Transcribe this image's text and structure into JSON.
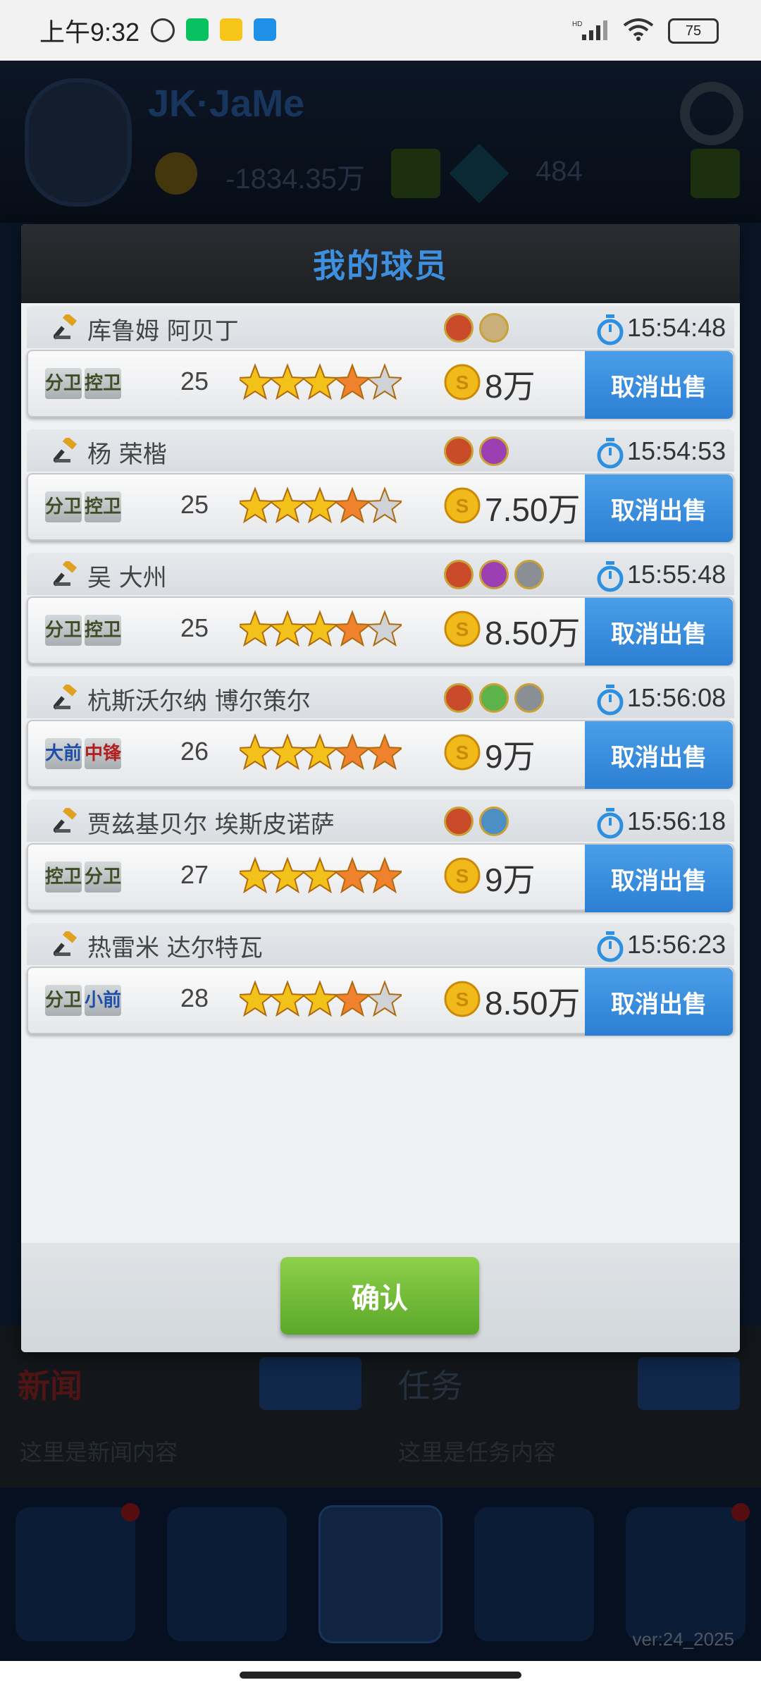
{
  "status_bar": {
    "time": "上午9:32",
    "battery": "75"
  },
  "background": {
    "player_name": "JK·JaMe",
    "money": "-1834.35万",
    "gems": "484",
    "news_title": "新闻",
    "news_text": "这里是新闻内容",
    "news_title2": "任务",
    "news_text2": "这里是任务内容",
    "version": "ver:24_2025"
  },
  "modal": {
    "title": "我的球员",
    "cancel_label": "取消出售",
    "confirm_label": "确认"
  },
  "players": [
    {
      "name": "库鲁姆 阿贝丁",
      "time": "15:54:48",
      "positions": [
        "分卫",
        "控卫"
      ],
      "age": "25",
      "stars": 3.5,
      "price": "8万",
      "skills": [
        "#c94b2a",
        "#c9b07a"
      ]
    },
    {
      "name": "杨 荣楷",
      "time": "15:54:53",
      "positions": [
        "分卫",
        "控卫"
      ],
      "age": "25",
      "stars": 3.5,
      "price": "7.50万",
      "skills": [
        "#c94b2a",
        "#9b3fb3"
      ]
    },
    {
      "name": "吴 大州",
      "time": "15:55:48",
      "positions": [
        "分卫",
        "控卫"
      ],
      "age": "25",
      "stars": 4,
      "price": "8.50万",
      "skills": [
        "#c94b2a",
        "#9b3fb3",
        "#8a8f96"
      ]
    },
    {
      "name": "杭斯沃尔纳 博尔策尔",
      "time": "15:56:08",
      "positions": [
        "大前",
        "中锋"
      ],
      "age": "26",
      "stars": 4.5,
      "price": "9万",
      "skills": [
        "#c94b2a",
        "#5bb34a",
        "#8a8f96"
      ]
    },
    {
      "name": "贾兹基贝尔 埃斯皮诺萨",
      "time": "15:56:18",
      "positions": [
        "控卫",
        "分卫"
      ],
      "age": "27",
      "stars": 4.5,
      "price": "9万",
      "skills": [
        "#c94b2a",
        "#4c8fc4"
      ]
    },
    {
      "name": "热雷米 达尔特瓦",
      "time": "15:56:23",
      "positions": [
        "分卫",
        "小前"
      ],
      "age": "28",
      "stars": 4,
      "price": "8.50万",
      "skills": []
    }
  ]
}
